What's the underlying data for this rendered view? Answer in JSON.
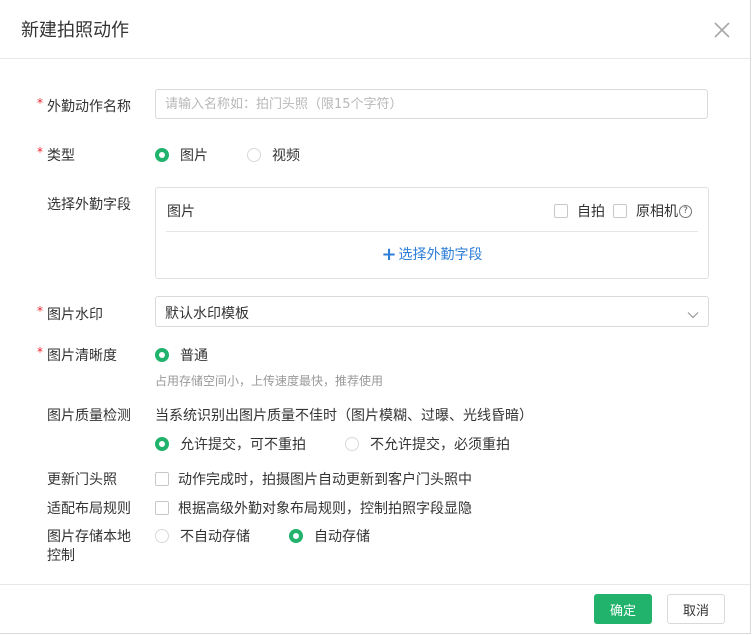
{
  "dialog": {
    "title": "新建拍照动作"
  },
  "form": {
    "name": {
      "label": "外勤动作名称",
      "placeholder": "请输入名称如：拍门头照（限15个字符）",
      "value": ""
    },
    "type": {
      "label": "类型",
      "options": [
        "图片",
        "视频"
      ],
      "selected": "图片"
    },
    "fields": {
      "label": "选择外勤字段",
      "item_title": "图片",
      "selfie_label": "自拍",
      "original_camera_label": "原相机",
      "help_glyph": "?",
      "add_label": "选择外勤字段",
      "add_plus": "+"
    },
    "watermark": {
      "label": "图片水印",
      "value": "默认水印模板"
    },
    "clarity": {
      "label": "图片清晰度",
      "option": "普通",
      "hint": "占用存储空间小，上传速度最快，推荐使用"
    },
    "quality_check": {
      "label": "图片质量检测",
      "desc": "当系统识别出图片质量不佳时（图片模糊、过曝、光线昏暗）",
      "options": [
        "允许提交，可不重拍",
        "不允许提交，必须重拍"
      ],
      "selected": "允许提交，可不重拍"
    },
    "update_storefront": {
      "label": "更新门头照",
      "checkbox_label": "动作完成时，拍摄图片自动更新到客户门头照中",
      "checked": false
    },
    "adapt_layout": {
      "label": "适配布局规则",
      "checkbox_label": "根据高级外勤对象布局规则，控制拍照字段显隐",
      "checked": false
    },
    "local_storage": {
      "label_line1": "图片存储本地",
      "label_line2": "控制",
      "options": [
        "不自动存储",
        "自动存储"
      ],
      "selected": "自动存储"
    }
  },
  "footer": {
    "ok_label": "确定",
    "cancel_label": "取消"
  },
  "colors": {
    "accent": "#21b36b",
    "link": "#2f7fd9",
    "required": "#f5222d"
  }
}
